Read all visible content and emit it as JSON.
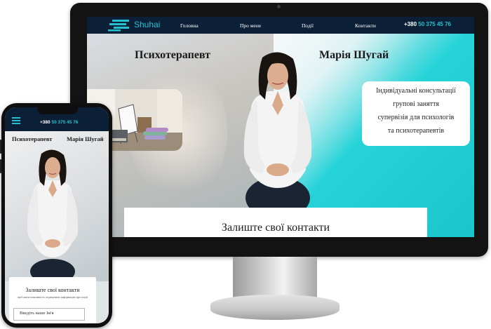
{
  "desktop": {
    "brand": "Shuhai",
    "nav": [
      "Головна",
      "Про мене",
      "Події",
      "Контакти"
    ],
    "phone": {
      "prefix": "+380",
      "number": "50 375 45 76"
    },
    "hero_left_title": "Психотерапевт",
    "hero_right_title": "Марія Шугай",
    "services": [
      "Індивідуальні консультації",
      "групові заняття",
      "супервізія для психологів",
      "та психотерапевтів"
    ],
    "form_title": "Залиште свої контакти"
  },
  "mobile": {
    "phone": {
      "prefix": "+380",
      "number": "50 375 45 76"
    },
    "hero_left_title": "Психотерапевт",
    "hero_right_title": "Марія Шугай",
    "form_title": "Залиште свої контакти",
    "form_subtitle": "щоб мати можливість отримувати інформацію про події",
    "input_placeholder": "Введіть ваше Ім'я"
  },
  "colors": {
    "nav_bg": "#0b2037",
    "accent": "#25c1cf",
    "hero_teal": "#19c6cc"
  }
}
